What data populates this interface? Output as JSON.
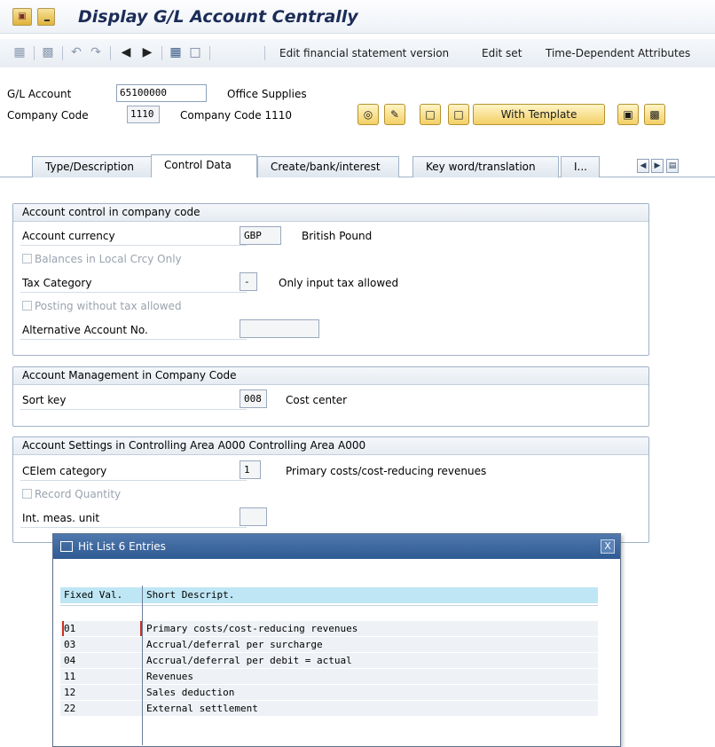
{
  "window": {
    "title": "Display G/L Account Centrally",
    "title_icon": "sap-transaction-icon"
  },
  "toolbar": {
    "icons": [
      "copy-icon",
      "hierarchy-icon",
      "undo-icon",
      "redo-icon",
      "previous-icon",
      "next-icon",
      "overview-icon",
      "document-icon"
    ],
    "edit_fsv": "Edit financial statement version",
    "edit_set": "Edit set",
    "time_dep": "Time-Dependent Attributes"
  },
  "header": {
    "gl_account_label": "G/L Account",
    "gl_account_value": "65100000",
    "gl_account_desc": "Office Supplies",
    "company_code_label": "Company Code",
    "company_code_value": "1110",
    "company_code_desc": "Company Code 1110",
    "with_template": "With Template"
  },
  "tabs": [
    {
      "label": "Type/Description",
      "active": false
    },
    {
      "label": "Control Data",
      "active": true
    },
    {
      "label": "Create/bank/interest",
      "active": false
    },
    {
      "label": "Key word/translation",
      "active": false
    },
    {
      "label": "I...",
      "active": false
    }
  ],
  "groups": {
    "account_control": {
      "title": "Account control in company code",
      "currency_label": "Account currency",
      "currency_value": "GBP",
      "currency_desc": "British Pound",
      "balances_local": "Balances in Local Crcy Only",
      "tax_category_label": "Tax Category",
      "tax_category_value": "-",
      "tax_category_desc": "Only input tax allowed",
      "posting_wo_tax": "Posting without tax allowed",
      "alt_account_label": "Alternative Account No.",
      "alt_account_value": ""
    },
    "account_mgmt": {
      "title": "Account Management in Company Code",
      "sort_key_label": "Sort key",
      "sort_key_value": "008",
      "sort_key_desc": "Cost center"
    },
    "account_settings": {
      "title": "Account Settings in Controlling Area A000 Controlling Area A000",
      "celem_label": "CElem category",
      "celem_value": "1",
      "celem_desc": "Primary costs/cost-reducing revenues",
      "record_qty": "Record Quantity",
      "int_meas_label": "Int. meas. unit",
      "int_meas_value": ""
    }
  },
  "hitlist": {
    "title": "Hit List 6 Entries",
    "close": "X",
    "col_fixed": "Fixed Val.",
    "col_desc": "Short Descript.",
    "rows": [
      {
        "val": "01",
        "desc": "Primary costs/cost-reducing revenues"
      },
      {
        "val": "03",
        "desc": "Accrual/deferral per surcharge"
      },
      {
        "val": "04",
        "desc": "Accrual/deferral per debit = actual"
      },
      {
        "val": "11",
        "desc": "Revenues"
      },
      {
        "val": "12",
        "desc": "Sales deduction"
      },
      {
        "val": "22",
        "desc": "External settlement"
      }
    ]
  }
}
